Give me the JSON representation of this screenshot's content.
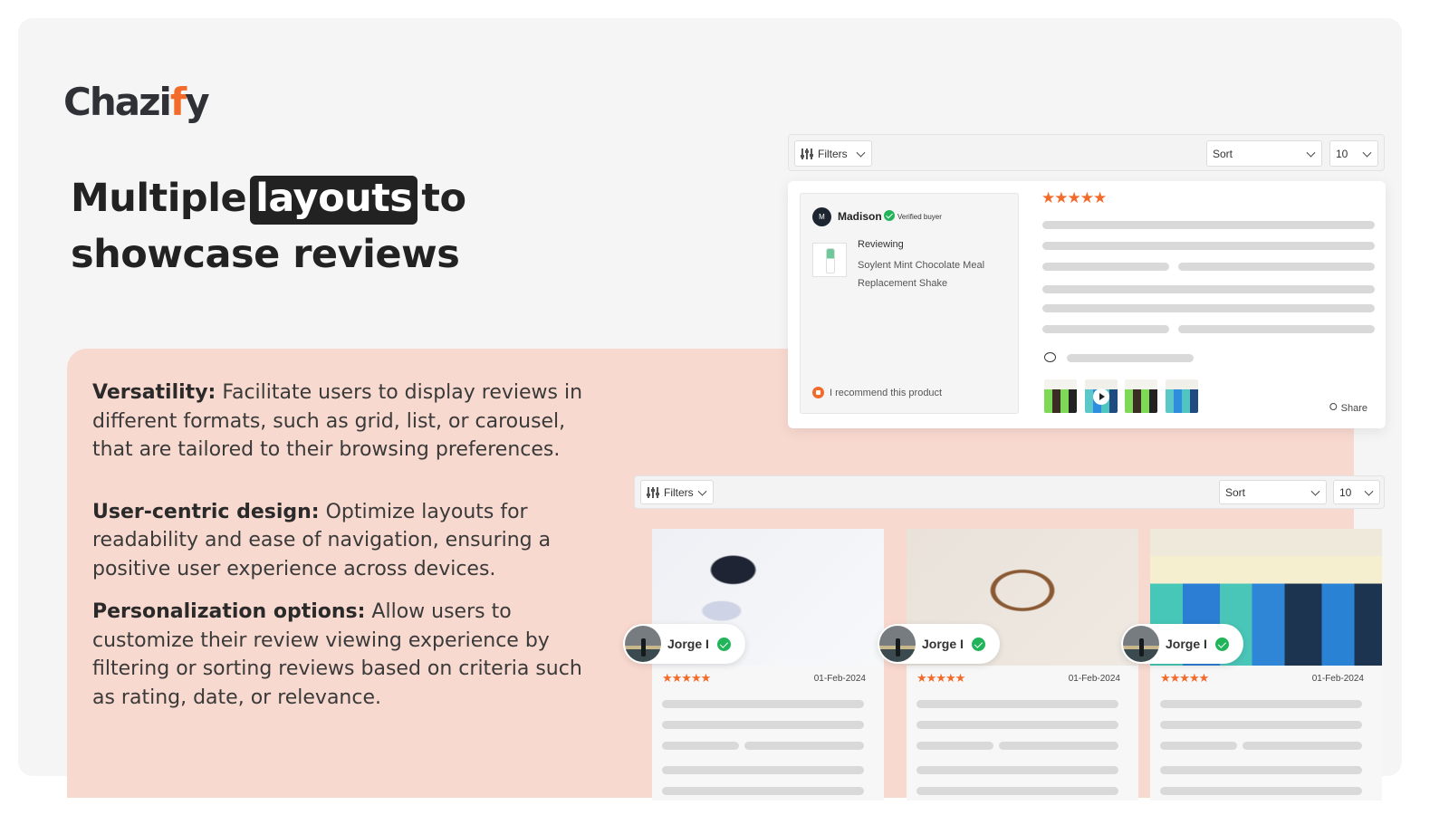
{
  "brand": {
    "logo_prefix": "Chazi",
    "logo_accent": "f",
    "logo_suffix": "y",
    "accent_color": "#f26b2a"
  },
  "headline": {
    "line1_before": "Multiple",
    "highlight": "layouts",
    "line1_after": "to",
    "line2": "showcase reviews"
  },
  "features": [
    {
      "title": "Versatility:",
      "text": " Facilitate users to display reviews in different formats, such as grid, list, or carousel, that are tailored to their browsing preferences."
    },
    {
      "title": "User-centric design:",
      "text": " Optimize layouts for readability and ease of navigation, ensuring a positive user experience across devices."
    },
    {
      "title": "Personalization options:",
      "text": " Allow users to customize their review viewing experience by filtering or sorting reviews based on criteria such as rating, date, or relevance."
    }
  ],
  "toolbar": {
    "filters_label": "Filters",
    "sort_label": "Sort",
    "per_page_value": "10"
  },
  "list_review": {
    "avatar_initial": "M",
    "reviewer": "Madison",
    "verified_label": "Verified buyer",
    "reviewing_label": "Reviewing",
    "product_name": "Soylent Mint Chocolate Meal Replacement Shake",
    "rating": 5,
    "stars": "★★★★★",
    "recommend_label": "I recommend this product",
    "share_label": "Share",
    "media_count": 4
  },
  "grid_reviews": [
    {
      "author": "Jorge I",
      "rating": 5,
      "stars": "★★★★★",
      "date": "01-Feb-2024",
      "photo": "sunglasses"
    },
    {
      "author": "Jorge I",
      "rating": 5,
      "stars": "★★★★★",
      "date": "01-Feb-2024",
      "photo": "tortoiseshell-glasses"
    },
    {
      "author": "Jorge I",
      "rating": 5,
      "stars": "★★★★★",
      "date": "01-Feb-2024",
      "photo": "soylent-bottles"
    }
  ]
}
